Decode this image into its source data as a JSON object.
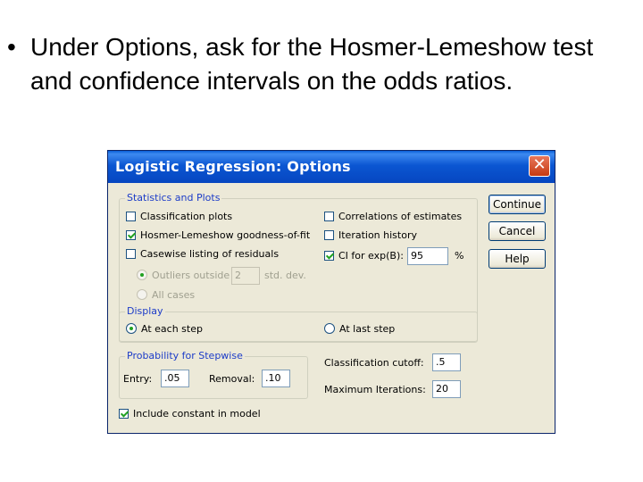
{
  "slide": {
    "bullet": "•",
    "text": "Under Options, ask for the Hosmer-Lemeshow test and confidence intervals on the odds ratios."
  },
  "dialog": {
    "title": "Logistic Regression: Options",
    "close_glyph": "✕",
    "statistics": {
      "legend": "Statistics and Plots",
      "classification_plots": {
        "label": "Classification plots",
        "checked": false
      },
      "hosmer": {
        "label": "Hosmer-Lemeshow goodness-of-fit",
        "checked": true
      },
      "casewise": {
        "label": "Casewise listing of residuals",
        "checked": false
      },
      "outliers": {
        "label": "Outliers outside",
        "value": "2",
        "unit": "std. dev."
      },
      "all_cases": {
        "label": "All cases"
      },
      "correlations": {
        "label": "Correlations of estimates",
        "checked": false
      },
      "iteration_history": {
        "label": "Iteration history",
        "checked": false
      },
      "ci": {
        "label": "CI for exp(B):",
        "checked": true,
        "value": "95",
        "unit": "%"
      }
    },
    "display": {
      "legend": "Display",
      "at_each_step": {
        "label": "At each step",
        "selected": true
      },
      "at_last_step": {
        "label": "At last step",
        "selected": false
      }
    },
    "stepwise": {
      "legend": "Probability for Stepwise",
      "entry_label": "Entry:",
      "entry_value": ".05",
      "removal_label": "Removal:",
      "removal_value": ".10"
    },
    "classification_cutoff": {
      "label": "Classification cutoff:",
      "value": ".5"
    },
    "maximum_iterations": {
      "label": "Maximum Iterations:",
      "value": "20"
    },
    "include_constant": {
      "label": "Include constant in model",
      "checked": true
    },
    "buttons": {
      "continue": "Continue",
      "cancel": "Cancel",
      "help": "Help"
    }
  }
}
